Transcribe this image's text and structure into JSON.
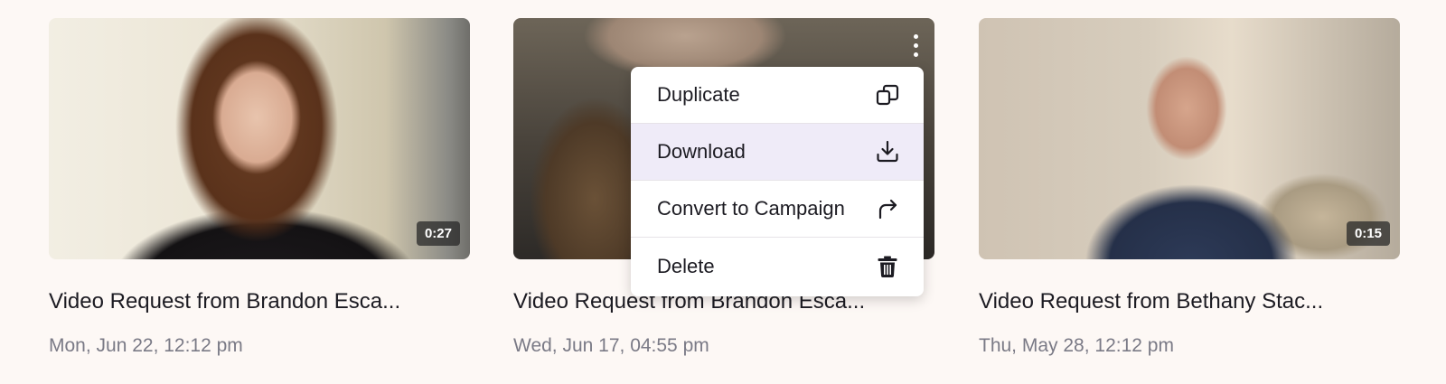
{
  "cards": [
    {
      "duration": "0:27",
      "title": "Video Request from Brandon Esca...",
      "date": "Mon, Jun 22, 12:12 pm"
    },
    {
      "duration": "",
      "title": "Video Request from Brandon Esca...",
      "date": "Wed, Jun 17, 04:55 pm"
    },
    {
      "duration": "0:15",
      "title": "Video Request from Bethany Stac...",
      "date": "Thu, May 28, 12:12 pm"
    }
  ],
  "menu": {
    "items": [
      {
        "label": "Duplicate",
        "icon": "duplicate-icon"
      },
      {
        "label": "Download",
        "icon": "download-icon",
        "highlighted": true
      },
      {
        "label": "Convert to Campaign",
        "icon": "share-arrow-icon"
      },
      {
        "label": "Delete",
        "icon": "trash-icon"
      }
    ]
  },
  "colors": {
    "background": "#fdf8f5",
    "highlight": "#efebf8",
    "text": "#1c1b22",
    "muted": "#7a7a86"
  }
}
